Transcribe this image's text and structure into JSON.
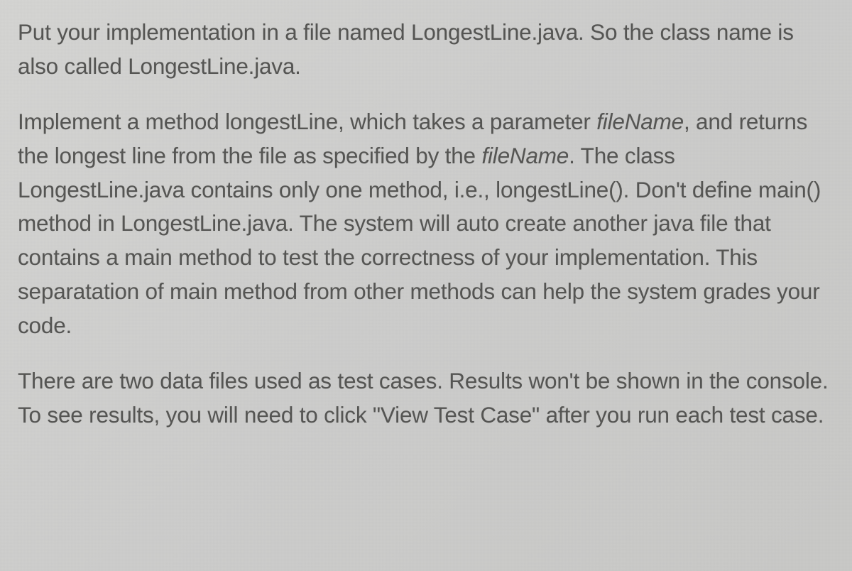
{
  "paragraphs": {
    "p1": {
      "text_before": "Put your implementation in a file named LongestLine.java. So the class name is also called LongestLine.java."
    },
    "p2": {
      "seg1": "Implement a method longestLine, which takes a parameter ",
      "italic1": "fileName",
      "seg2": ", and returns the longest line from the file as specified by the ",
      "italic2": "fileName",
      "seg3": ". The class LongestLine.java contains only one method, i.e., longestLine(). Don't define main() method in LongestLine.java. The system will auto create another java file that contains a main method to test the correctness of your implementation. This separatation of main method from other methods can help the system grades your code."
    },
    "p3": {
      "text": "There are two data files used as test cases. Results won't be shown in the console. To see results, you will need to click \"View Test Case\" after you run each test case."
    }
  }
}
